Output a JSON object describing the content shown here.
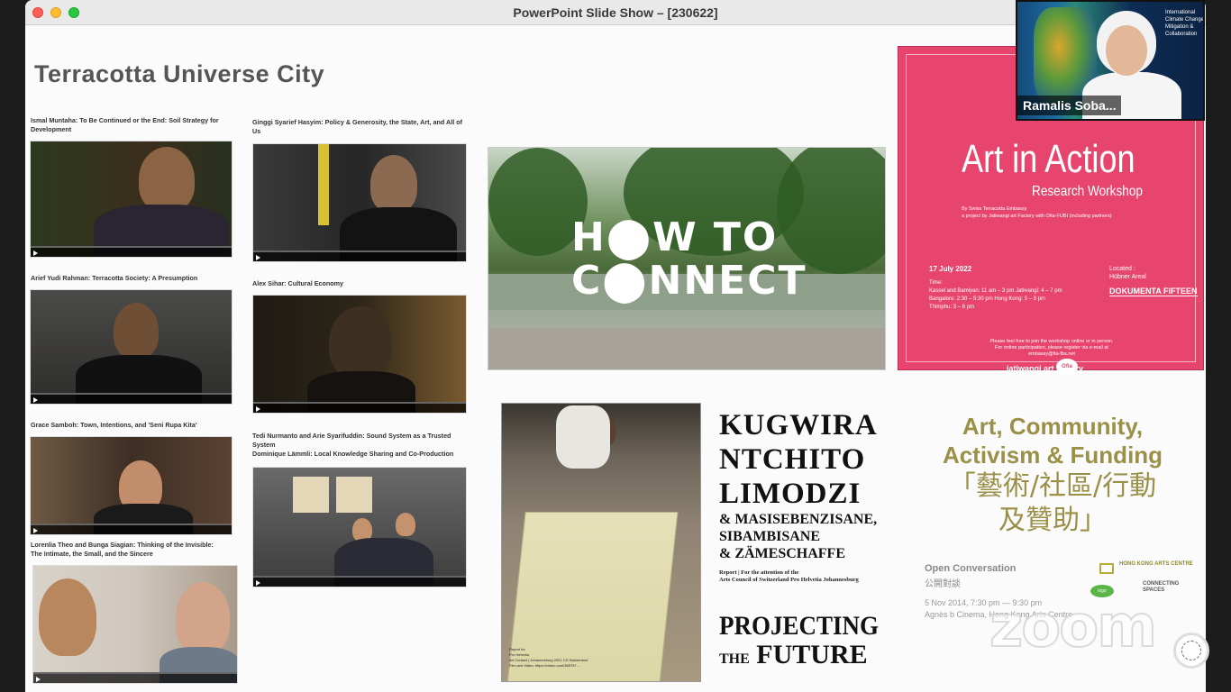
{
  "window": {
    "title": "PowerPoint Slide Show – [230622]"
  },
  "slide": {
    "title": "Terracotta Universe City",
    "videos": [
      {
        "caption": "Ismal Muntaha: To Be Continued or the End: Soil Strategy for Development"
      },
      {
        "caption": "Ginggi Syarief Hasyim: Policy & Generosity, the State, Art, and All of Us"
      },
      {
        "caption": "Arief Yudi Rahman: Terracotta Society: A Presumption"
      },
      {
        "caption": "Alex Sihar: Cultural Economy"
      },
      {
        "caption": "Grace Samboh: Town, Intentions, and 'Seni Rupa Kita'"
      },
      {
        "caption": "Tedi Nurmanto and Arie Syarifuddin: Sound System as a Trusted System\nDominique Lämmli: Local Knowledge Sharing and Co-Production"
      },
      {
        "caption": "Lorenlia Theo and Bunga Siagian: Thinking of the Invisible: The Intimate, the Small, and the Sincere"
      }
    ],
    "how_to_connect": {
      "line1": "H⬤W TO",
      "line2": "C⬤NNECT"
    },
    "art_in_action": {
      "title": "Art in Action",
      "subtitle": "Research Workshop",
      "by": "By Swiss Terracotta Embassy\na project by Jatiwangi art Factory with Ofia-FUBI (including partners)",
      "date": "17 July 2022",
      "times": "Time:\nKassel and Bamiyan: 11 am – 3 pm    Jatiwangi: 4 – 7 pm\nBangalore: 2:30 – 5:30 pm    Hong Kong: 5 – 8 pm\nThimphu: 3 – 6 pm",
      "located": "Located :\nHübner Areal",
      "documenta": "DOKUMENTA FIFTEEN",
      "join": "Please feel free to join the workshop online or in person.\nFor online participation, please register via e-mail at embassy@fia-fbs.net",
      "logo1": "jatiwangi art factory",
      "logo2": "Ofia"
    },
    "kugwira": {
      "line1": "KUGWIRA",
      "line2": "NTCHITO",
      "line3": "LIMODZI",
      "line4": "& MASISEBENZISANE,",
      "line5": "SIBAMBISANE",
      "line6": "& ZÄMESCHAFFE",
      "report": "Report | For the attention of the\nArts Council of Switzerland Pro Helvetia Johannesburg",
      "proj1": "PROJECTING",
      "the": "THE",
      "future": "FUTURE",
      "photo_caption": "Report for\nPro Helvetia\nArt Contact | Johannesburg 2021 CH Switzerland\nFilm and Video: https://vimeo.com/365797..."
    },
    "acaf": {
      "line1": "Art, Community,",
      "line2": "Activism & Funding",
      "cn1": "「藝術/社區/行動",
      "cn2": "及贊助」",
      "open": "Open Conversation",
      "open_cn": "公開對談",
      "date": "5 Nov 2014, 7:30 pm — 9:30 pm",
      "venue": "Agnès b Cinema, Hong Kong Arts Centre",
      "hkac": "HONG KONG ARTS CENTRE",
      "csp": "CONNECTING SPACES",
      "green": "logo"
    }
  },
  "participant": {
    "name": "Ramalis Soba...",
    "bg_text": "International Climate Change Mitigation & Collaboration"
  },
  "watermark": "zoom"
}
